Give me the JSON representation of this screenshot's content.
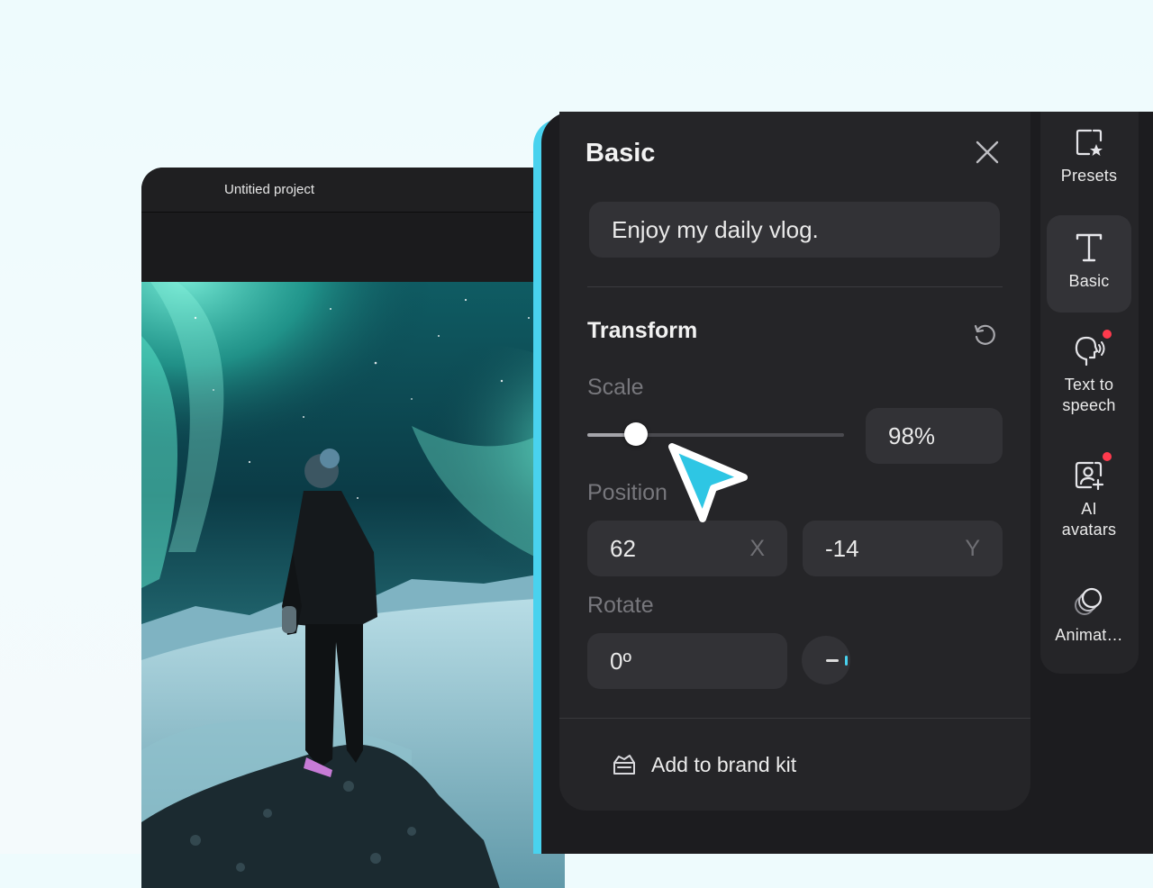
{
  "editor": {
    "title": "Untitied project"
  },
  "panel": {
    "title": "Basic",
    "text_value": "Enjoy my daily vlog.",
    "transform": {
      "title": "Transform",
      "scale": {
        "label": "Scale",
        "value": "98%",
        "slider_fraction": 0.19
      },
      "position": {
        "label": "Position",
        "x_value": "62",
        "x_axis": "X",
        "y_value": "-14",
        "y_axis": "Y"
      },
      "rotate": {
        "label": "Rotate",
        "value": "0º"
      }
    },
    "brand_kit_label": "Add to brand kit"
  },
  "rail": {
    "items": [
      {
        "label": "Presets",
        "icon": "presets-icon",
        "badge": false
      },
      {
        "label": "Basic",
        "icon": "text-icon",
        "badge": false,
        "active": true
      },
      {
        "label": "Text to speech",
        "icon": "speech-icon",
        "badge": true
      },
      {
        "label": "AI avatars",
        "icon": "avatar-icon",
        "badge": true
      },
      {
        "label": "Animat…",
        "icon": "animation-icon",
        "badge": false
      }
    ]
  },
  "colors": {
    "accent": "#49d2ee",
    "badge": "#ff3a4d",
    "panel_bg": "#252528",
    "field_bg": "#323236"
  }
}
